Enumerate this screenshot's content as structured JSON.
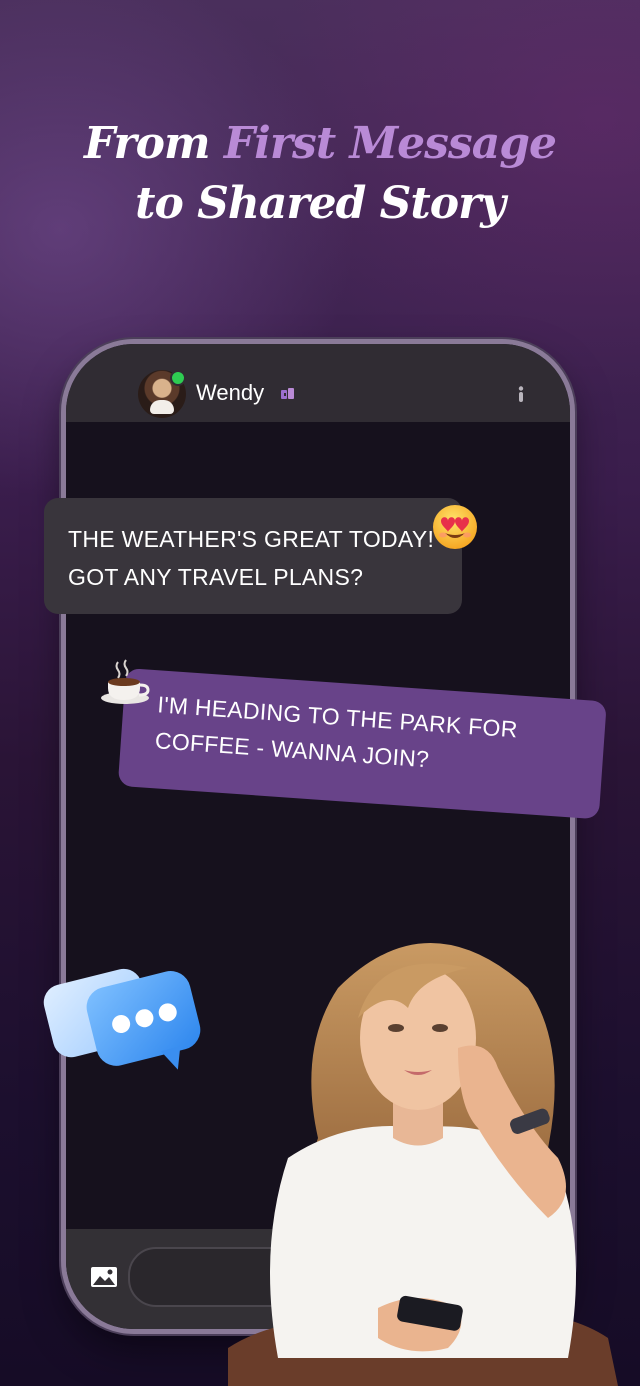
{
  "headline": {
    "line1_part1": "From ",
    "line1_accent": "First Message",
    "line2": "to Shared Story"
  },
  "chat_header": {
    "contact_name": "Wendy",
    "online": true,
    "badge_icon": "verified-badge-icon",
    "menu_icon": "more-vertical-icon"
  },
  "messages": [
    {
      "direction": "incoming",
      "line1": "THE WEATHER'S GREAT TODAY!",
      "line2": "GOT ANY TRAVEL PLANS?",
      "emoji": "heart-eyes-emoji"
    },
    {
      "direction": "outgoing",
      "line1": "I'M HEADING TO THE PARK FOR",
      "line2": "COFFEE - WANNA JOIN?",
      "emoji": "coffee-cup-emoji"
    }
  ],
  "composer": {
    "attach_icon": "image-gallery-icon",
    "input_value": ""
  },
  "decorations": {
    "sticker": "typing-chat-bubbles-icon",
    "photo": "smiling woman with phone"
  },
  "colors": {
    "accent": "#b98ad6",
    "outgoing_bubble": "#684389",
    "incoming_bubble": "#39353c",
    "online_dot": "#2ecc52"
  }
}
